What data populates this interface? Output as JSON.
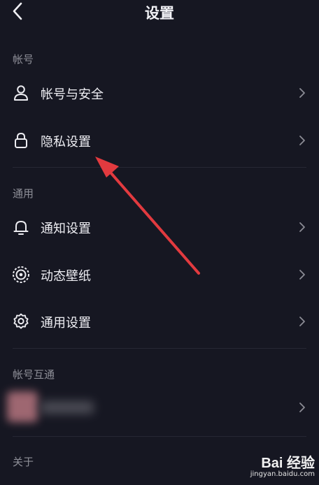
{
  "header": {
    "title": "设置"
  },
  "sections": {
    "account": "帐号",
    "general": "通用",
    "linked": "帐号互通",
    "about": "关于"
  },
  "items": {
    "account_security": "帐号与安全",
    "privacy": "隐私设置",
    "notifications": "通知设置",
    "wallpaper": "动态壁纸",
    "general_settings": "通用设置"
  },
  "watermark": {
    "brand": "Bai 经验",
    "url": "jingyan.baidu.com"
  },
  "icons": {
    "back": "back-arrow-icon",
    "account": "user-icon",
    "privacy": "lock-icon",
    "notifications": "bell-icon",
    "wallpaper": "wallpaper-icon",
    "general": "gear-icon",
    "chevron": "chevron-right-icon"
  },
  "colors": {
    "background": "#161722",
    "annotation_arrow": "#e23a3f"
  }
}
